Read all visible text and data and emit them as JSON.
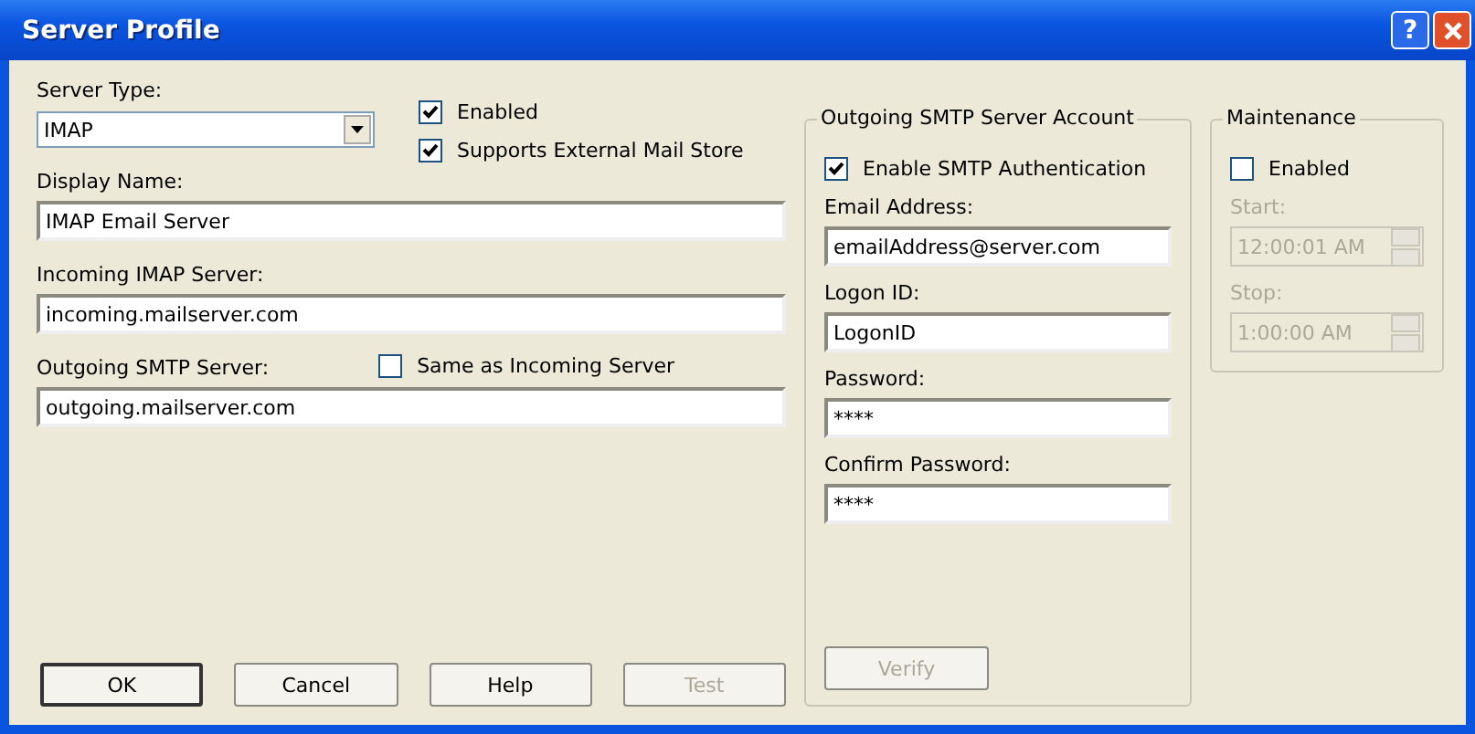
{
  "window": {
    "title": "Server Profile",
    "help_button": "?"
  },
  "server_type": {
    "label": "Server Type:",
    "value": "IMAP"
  },
  "options": [
    {
      "label": "Enabled",
      "checked": true
    },
    {
      "label": "Supports External Mail Store",
      "checked": true
    }
  ],
  "fields": [
    {
      "label": "Display Name:",
      "value": "IMAP Email Server"
    },
    {
      "label": "Incoming IMAP Server:",
      "value": "incoming.mailserver.com"
    },
    {
      "label": "Outgoing SMTP Server:",
      "value": "outgoing.mailserver.com"
    }
  ],
  "same_as_incoming": {
    "label": "Same as Incoming Server",
    "checked": false
  },
  "buttons": [
    {
      "label": "OK",
      "default": true,
      "disabled": false
    },
    {
      "label": "Cancel",
      "default": false,
      "disabled": false
    },
    {
      "label": "Help",
      "default": false,
      "disabled": false
    },
    {
      "label": "Test",
      "default": false,
      "disabled": true
    }
  ],
  "smtp_account": {
    "title": "Outgoing SMTP Server Account",
    "auth": {
      "label": "Enable SMTP Authentication",
      "checked": true
    },
    "fields": [
      {
        "label": "Email Address:",
        "value": "emailAddress@server.com"
      },
      {
        "label": "Logon ID:",
        "value": "LogonID"
      },
      {
        "label": "Password:",
        "value": "****"
      },
      {
        "label": "Confirm Password:",
        "value": "****"
      }
    ],
    "verify": {
      "label": "Verify",
      "disabled": true
    }
  },
  "maintenance": {
    "title": "Maintenance",
    "enabled": {
      "label": "Enabled",
      "checked": false
    },
    "times": [
      {
        "label": "Start:",
        "value": "12:00:01 AM",
        "disabled": true
      },
      {
        "label": "Stop:",
        "value": "1:00:00 AM",
        "disabled": true
      }
    ]
  }
}
